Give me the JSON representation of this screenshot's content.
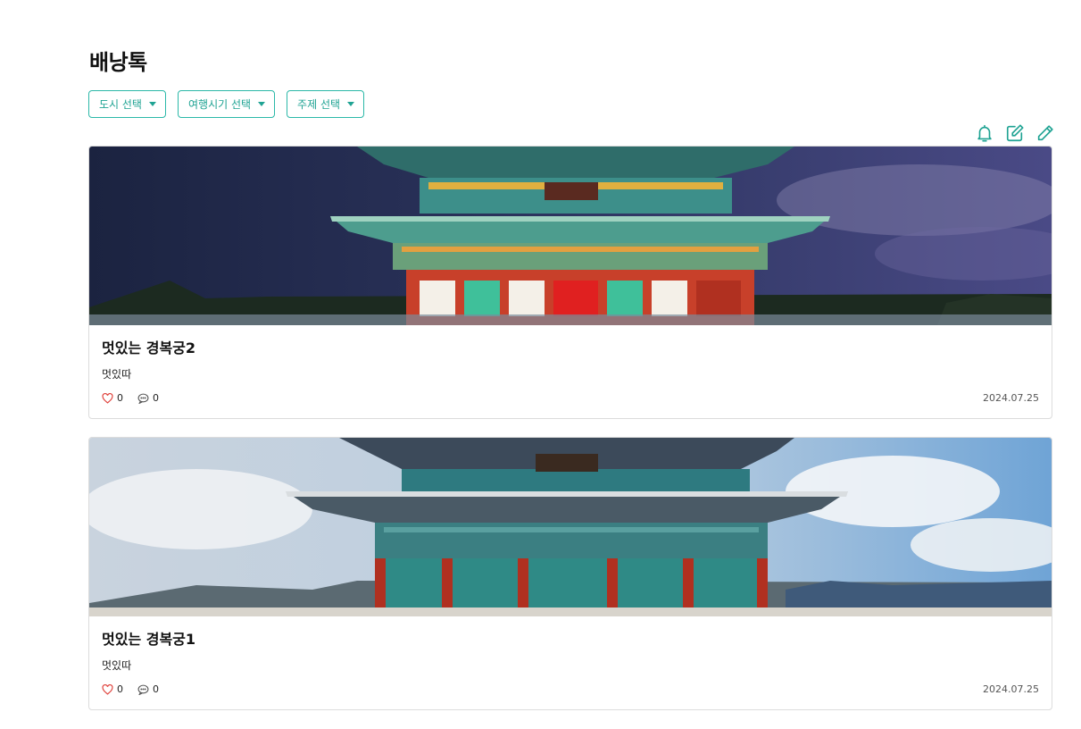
{
  "page": {
    "title": "배낭톡"
  },
  "filters": [
    {
      "label": "도시 선택"
    },
    {
      "label": "여행시기 선택"
    },
    {
      "label": "주제 선택"
    }
  ],
  "toolbar": {
    "icons": [
      "bell-icon",
      "edit-square-icon",
      "pencil-icon"
    ]
  },
  "colors": {
    "accent": "#1fa393",
    "heart": "#e0443e"
  },
  "posts": [
    {
      "title": "멋있는 경복궁2",
      "description": "멋있따",
      "likes": "0",
      "comments": "0",
      "date": "2024.07.25",
      "scene": "night"
    },
    {
      "title": "멋있는 경복궁1",
      "description": "멋있따",
      "likes": "0",
      "comments": "0",
      "date": "2024.07.25",
      "scene": "day"
    }
  ]
}
